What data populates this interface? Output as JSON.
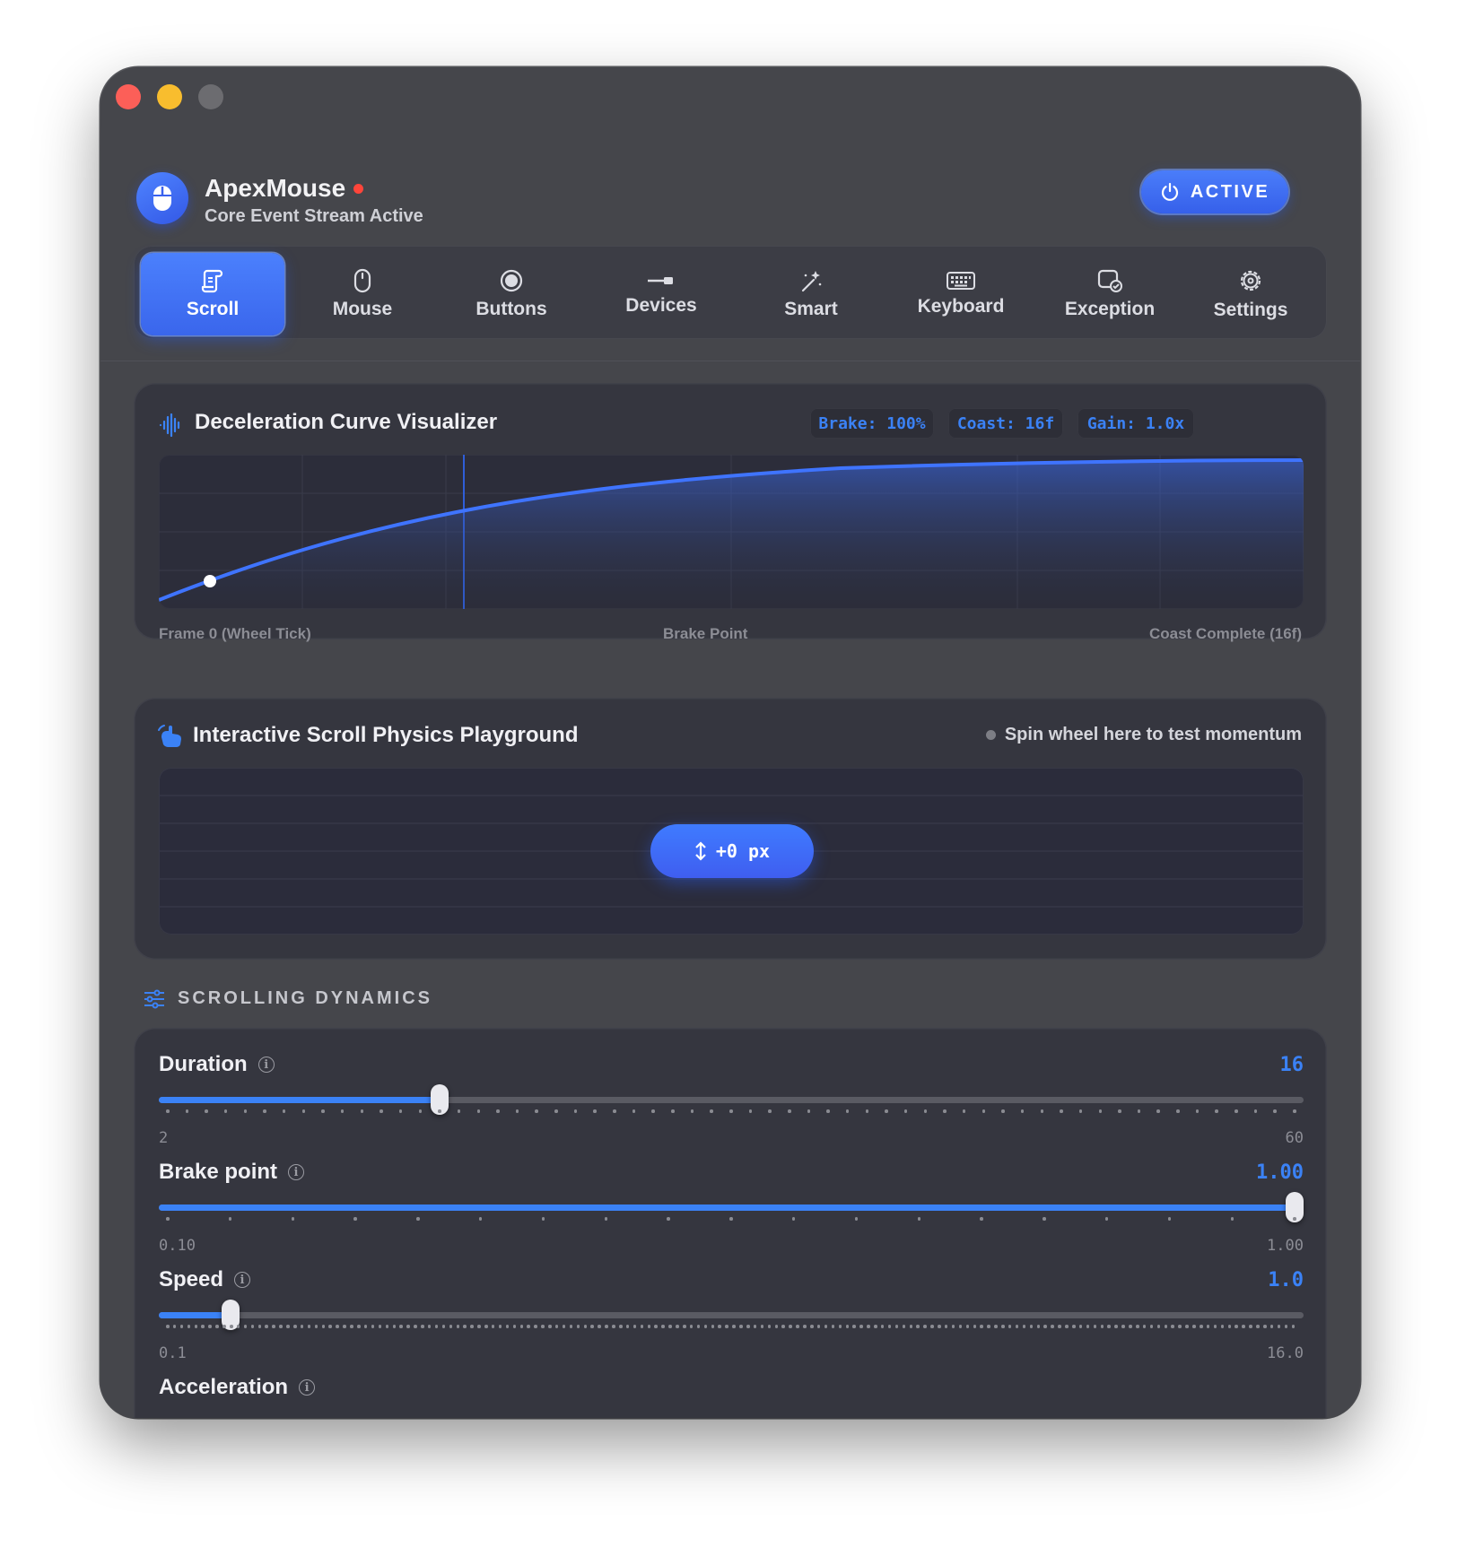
{
  "header": {
    "app_name": "ApexMouse",
    "subtitle": "Core Event Stream Active",
    "status_button": "ACTIVE"
  },
  "tabs": [
    {
      "label": "Scroll",
      "icon": "scroll-icon",
      "selected": true
    },
    {
      "label": "Mouse",
      "icon": "mouse-icon"
    },
    {
      "label": "Buttons",
      "icon": "button-circle-icon"
    },
    {
      "label": "Devices",
      "icon": "usb-icon"
    },
    {
      "label": "Smart",
      "icon": "magic-wand-icon"
    },
    {
      "label": "Keyboard",
      "icon": "keyboard-icon"
    },
    {
      "label": "Exception",
      "icon": "exception-icon"
    },
    {
      "label": "Settings",
      "icon": "gear-icon"
    }
  ],
  "visualizer": {
    "title": "Deceleration Curve Visualizer",
    "chips": [
      "Brake: 100%",
      "Coast: 16f",
      "Gain: 1.0x"
    ],
    "axis_labels": {
      "start": "Frame 0 (Wheel Tick)",
      "middle": "Brake Point",
      "end": "Coast Complete (16f)"
    }
  },
  "playground": {
    "title": "Interactive Scroll Physics Playground",
    "hint": "Spin wheel here to test momentum",
    "offset": "+0 px"
  },
  "dynamics": {
    "section_title": "SCROLLING DYNAMICS",
    "params": [
      {
        "name": "Duration",
        "value": "16",
        "min": "2",
        "max": "60",
        "fraction": 0.245,
        "ticks": 59
      },
      {
        "name": "Brake point",
        "value": "1.00",
        "min": "0.10",
        "max": "1.00",
        "fraction": 1.0,
        "ticks": 19
      },
      {
        "name": "Speed",
        "value": "1.0",
        "min": "0.1",
        "max": "16.0",
        "fraction": 0.063,
        "ticks": 160
      }
    ],
    "partial_next": "Acceleration"
  },
  "colors": {
    "accent": "#3b82f6",
    "window": "#45464b",
    "card": "#35363f",
    "live": "#ff453a"
  }
}
